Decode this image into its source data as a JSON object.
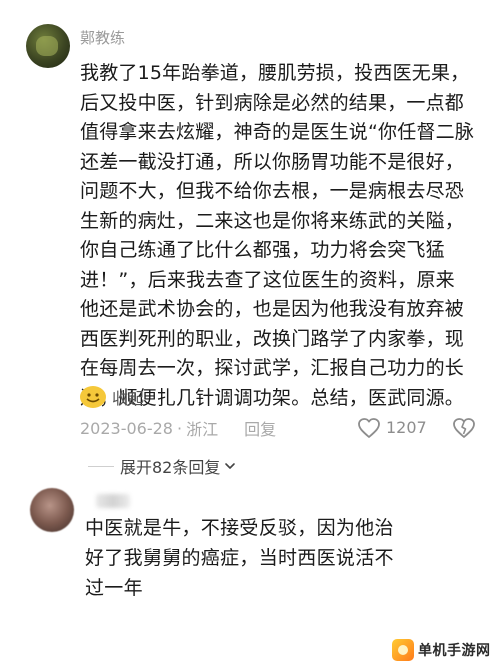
{
  "comments": [
    {
      "username": "鄚教练",
      "lines": [
        "我教了15年跆拳道，腰肌劳损，投西医无果，",
        "后又投中医，针到病除是必然的结果，一点都",
        "值得拿来去炫耀，神奇的是医生说“你任督二脉",
        "还差一截没打通，所以你肠胃功能不是很好，",
        "问题不大，但我不给你去根，一是病根去尽恐",
        "生新的病灶，二来这也是你将来练武的关隘，",
        "你自己练通了比什么都强，功力将会突飞猛",
        "进！”，后来我去查了这位医生的资料，原来",
        "他还是武术协会的，也是因为他我没有放弃被",
        "西医判死刑的职业，改换门路学了内家拳，现",
        "在每周去一次，探讨武学，汇报自己功力的长",
        "进，顺便扎几针调调功架。总结，医武同源。"
      ],
      "collapse_label": "收起",
      "date": "2023-06-28",
      "separator": "·",
      "location": "浙江",
      "reply_label": "回复",
      "like_count": "1207"
    },
    {
      "username": "",
      "lines": [
        "中医就是牛，不接受反驳，因为他治",
        "好了我舅舅的癌症，当时西医说活不",
        "过一年"
      ]
    }
  ],
  "expand_label": "展开82条回复",
  "watermark_text": "单机手游网",
  "icons": {
    "collapse": "grin-emoji-icon",
    "like": "heart-icon",
    "dislike": "broken-heart-icon",
    "expand": "chevron-down-icon",
    "watermark": "site-logo-icon"
  }
}
